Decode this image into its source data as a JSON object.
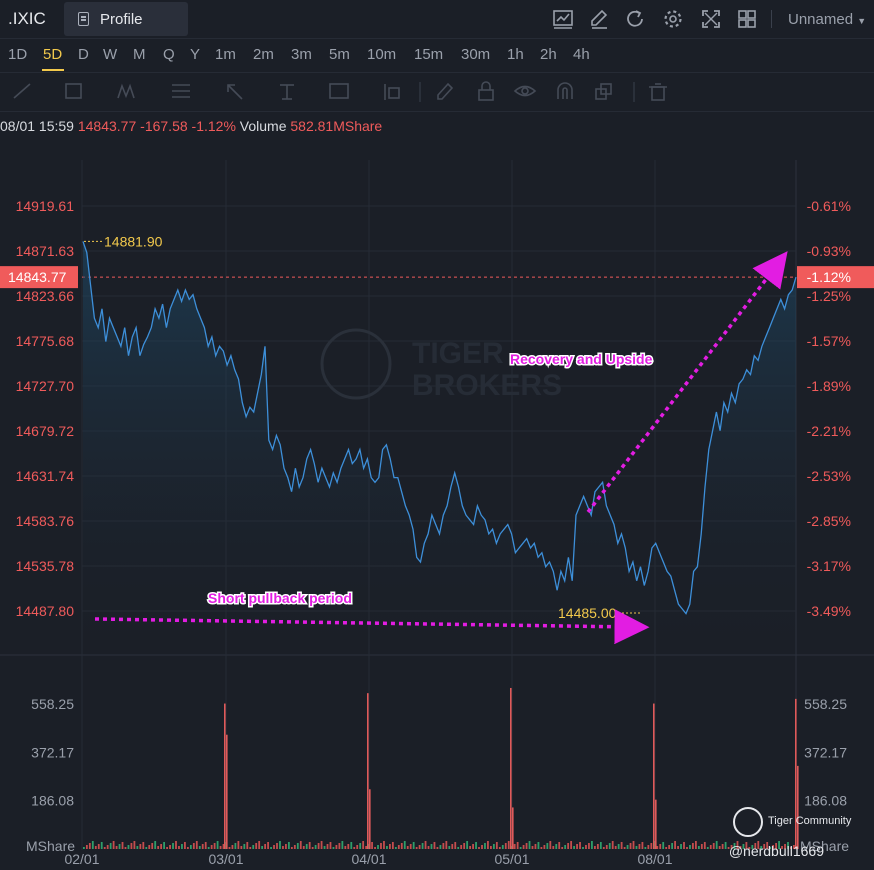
{
  "header": {
    "symbol": ".IXIC",
    "profile_tab": "Profile",
    "workspace": "Unnamed",
    "icons": [
      "chart-icon",
      "pencil-icon",
      "refresh-icon",
      "gear-icon",
      "fullscreen-icon",
      "layout-grid-icon"
    ]
  },
  "timeframes": [
    "1D",
    "5D",
    "D",
    "W",
    "M",
    "Q",
    "Y",
    "1m",
    "2m",
    "3m",
    "5m",
    "10m",
    "15m",
    "30m",
    "1h",
    "2h",
    "4h"
  ],
  "active_timeframe": "5D",
  "drawing_tools": [
    "line-tool-icon",
    "rectangle-tool-icon",
    "pattern-tool-icon",
    "fib-tool-icon",
    "arrow-tool-icon",
    "text-tool-icon",
    "note-tool-icon",
    "measure-tool-icon",
    "pen-icon",
    "lock-icon",
    "eye-icon",
    "magnet-icon",
    "copy-icon",
    "trash-icon"
  ],
  "quote": {
    "datetime": "08/01 15:59",
    "price": "14843.77",
    "change": "-167.58",
    "change_pct": "-1.12%",
    "volume_label": "Volume",
    "volume_value": "582.81MShare"
  },
  "chart_data": {
    "type": "area",
    "price_axis": [
      "14919.61",
      "14871.63",
      "14823.66",
      "14775.68",
      "14727.70",
      "14679.72",
      "14631.74",
      "14583.76",
      "14535.78",
      "14487.80"
    ],
    "pct_axis": [
      "-0.61%",
      "-0.93%",
      "-1.25%",
      "-1.57%",
      "-1.89%",
      "-2.21%",
      "-2.53%",
      "-2.85%",
      "-3.17%",
      "-3.49%"
    ],
    "current_price_label": "14843.77",
    "current_pct_label": "-1.12%",
    "high_label": "14881.90",
    "low_label": "14485.00",
    "x_ticks": [
      "02/01",
      "03/01",
      "04/01",
      "05/01",
      "08/01"
    ],
    "volume_axis": [
      "558.25",
      "372.17",
      "186.08"
    ],
    "volume_unit": "MShare",
    "watermark": [
      "TIGER",
      "BROKERS"
    ],
    "annotations": [
      "Recovery and Upside",
      "Short pullback period"
    ],
    "series": [
      {
        "values": [
          14881.9,
          14870,
          14835,
          14800,
          14790,
          14810,
          14775,
          14800,
          14790,
          14780,
          14770,
          14790,
          14760,
          14780,
          14790,
          14760,
          14772,
          14780,
          14790,
          14810,
          14800,
          14815,
          14790,
          14810,
          14820,
          14830,
          14818,
          14830,
          14820,
          14825,
          14810,
          14800,
          14790,
          14770,
          14780,
          14760,
          14770,
          14765,
          14750,
          14760,
          14745,
          14735,
          14710,
          14695,
          14705,
          14700,
          14720,
          14740,
          14770,
          14670,
          14660,
          14675,
          14665,
          14640,
          14630,
          14615,
          14640,
          14620,
          14630,
          14650,
          14660,
          14645,
          14625,
          14640,
          14630,
          14620,
          14635,
          14625,
          14640,
          14650,
          14660,
          14645,
          14650,
          14660,
          14640,
          14650,
          14630,
          14625,
          14630,
          14660,
          14665,
          14650,
          14630,
          14630,
          14615,
          14600,
          14590,
          14575,
          14545,
          14540,
          14560,
          14570,
          14590,
          14580,
          14570,
          14590,
          14600,
          14620,
          14635,
          14620,
          14600,
          14590,
          14585,
          14580,
          14600,
          14590,
          14585,
          14570,
          14575,
          14560,
          14570,
          14575,
          14580,
          14570,
          14550,
          14555,
          14560,
          14565,
          14555,
          14560,
          14545,
          14550,
          14535,
          14540,
          14530,
          14510,
          14530,
          14520,
          14545,
          14520,
          14590,
          14600,
          14610,
          14600,
          14590,
          14615,
          14620,
          14625,
          14600,
          14590,
          14580,
          14560,
          14570,
          14555,
          14530,
          14540,
          14520,
          14535,
          14515,
          14530,
          14555,
          14560,
          14550,
          14540,
          14530,
          14525,
          14510,
          14495,
          14490,
          14485,
          14495,
          14530,
          14535,
          14570,
          14620,
          14660,
          14680,
          14700,
          14680,
          14710,
          14700,
          14720,
          14710,
          14730,
          14735,
          14745,
          14740,
          14760,
          14755,
          14770,
          14780,
          14790,
          14800,
          14810,
          14820,
          14810,
          14825,
          14830,
          14843.77
        ]
      }
    ],
    "volume_spikes": [
      560,
      440,
      600,
      230,
      620,
      160,
      560,
      190,
      578,
      320
    ]
  }
}
